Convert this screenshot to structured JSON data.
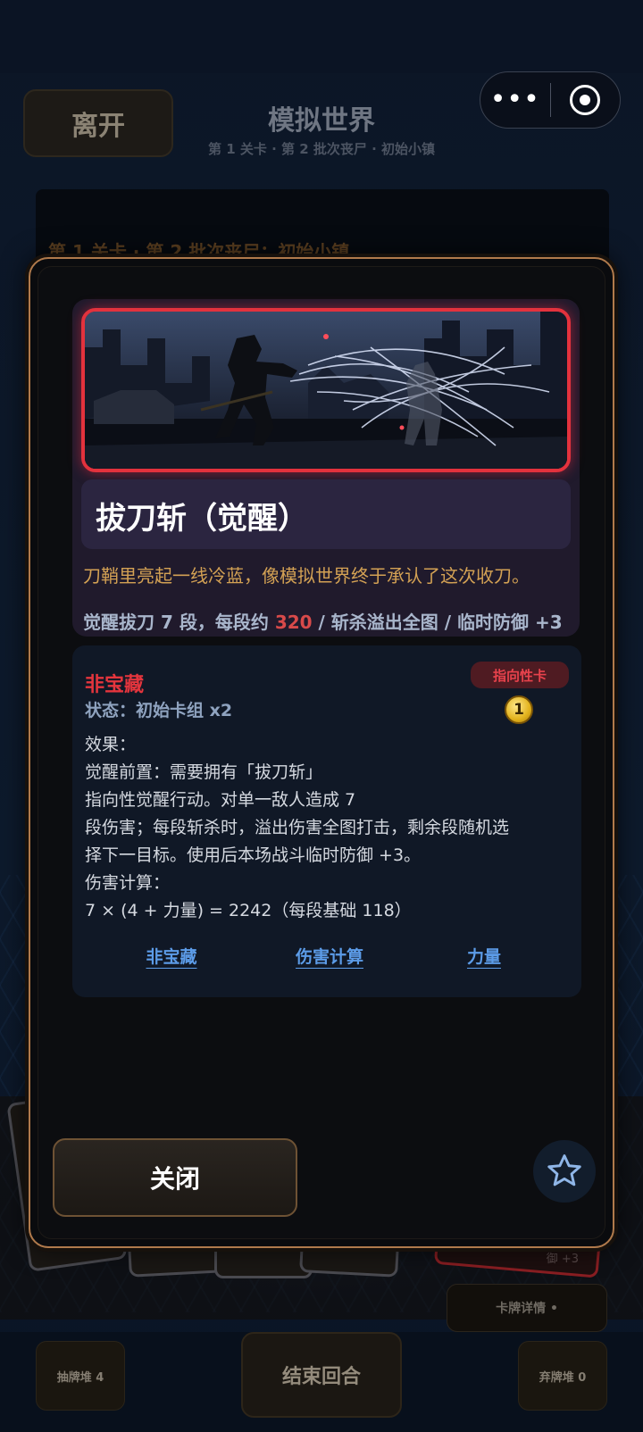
{
  "header": {
    "leave_label": "离开",
    "title": "模拟世界",
    "subtitle": "第 1 关卡 · 第 2 批次丧尸 · 初始小镇",
    "capsule_more": "•••"
  },
  "background": {
    "stage_line": "第 1 关卡 · 第 2 批次丧尸：初始小镇。",
    "card_fragment": "溢出全图 / 临时防御 +3",
    "card_detail_label": "卡牌详情 •",
    "draw_pile_label": "抽牌堆 4",
    "end_turn_label": "结束回合",
    "discard_pile_label": "弃牌堆 0"
  },
  "card": {
    "name": "拔刀斩（觉醒）",
    "flavor": "刀鞘里亮起一线冷蓝，像模拟世界终于承认了这次收刀。",
    "summary_prefix": "觉醒拔刀 7 段，每段约 ",
    "summary_value": "320",
    "summary_suffix": " / 斩杀溢出全图 / 临时防御 +3",
    "rarity": "非宝藏",
    "status": "状态：初始卡组 x2",
    "tag": "指向性卡",
    "cost": "1",
    "effect_lines": [
      "效果：",
      "觉醒前置：需要拥有「拔刀斩」",
      "指向性觉醒行动。对单一敌人造成 7",
      "段伤害；每段斩杀时，溢出伤害全图打击，剩余段随机选",
      "择下一目标。使用后本场战斗临时防御 +3。",
      "伤害计算：",
      "7 × (4 + 力量) = 2242（每段基础 118）"
    ],
    "links": [
      "非宝藏",
      "伤害计算",
      "力量"
    ]
  },
  "modal": {
    "close_label": "关闭",
    "favorite_icon": "star-outline-icon"
  },
  "colors": {
    "accent_red": "#e3323d",
    "gold_text": "#d3a154",
    "link_blue": "#5c9ce8",
    "modal_border": "#b07a4c"
  }
}
